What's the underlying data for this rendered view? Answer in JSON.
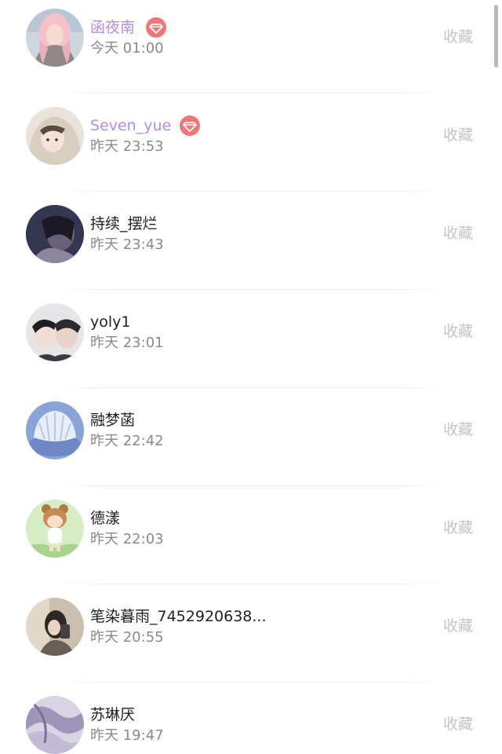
{
  "list": {
    "items": [
      {
        "name": "函夜南",
        "time": "今天 01:00",
        "action": "收藏",
        "vip": true,
        "avatar": "avatar-girl-pink-hair"
      },
      {
        "name": "Seven_yue",
        "time": "昨天 23:53",
        "action": "收藏",
        "vip": true,
        "avatar": "avatar-girl-hood"
      },
      {
        "name": "持续_摆烂",
        "time": "昨天 23:43",
        "action": "收藏",
        "vip": false,
        "avatar": "avatar-dark-portrait"
      },
      {
        "name": "yoly1",
        "time": "昨天 23:01",
        "action": "收藏",
        "vip": false,
        "avatar": "avatar-two-boys"
      },
      {
        "name": "融梦菡",
        "time": "昨天 22:42",
        "action": "收藏",
        "vip": false,
        "avatar": "avatar-blue-shell"
      },
      {
        "name": "德漾",
        "time": "昨天 22:03",
        "action": "收藏",
        "vip": false,
        "avatar": "avatar-cartoon-bear"
      },
      {
        "name": "笔染暮雨_7452920638...",
        "time": "昨天 20:55",
        "action": "收藏",
        "vip": false,
        "avatar": "avatar-girl-mirror"
      },
      {
        "name": "苏琳厌",
        "time": "昨天 19:47",
        "action": "收藏",
        "vip": false,
        "avatar": "avatar-purple-abstract"
      }
    ]
  },
  "colors": {
    "vip_name": "#b38be8",
    "vip_badge": "#ef7777",
    "name": "#222222",
    "time": "#8a8a8a",
    "action": "#c4c4c4"
  },
  "icons": {
    "vip_badge": "diamond-icon"
  }
}
